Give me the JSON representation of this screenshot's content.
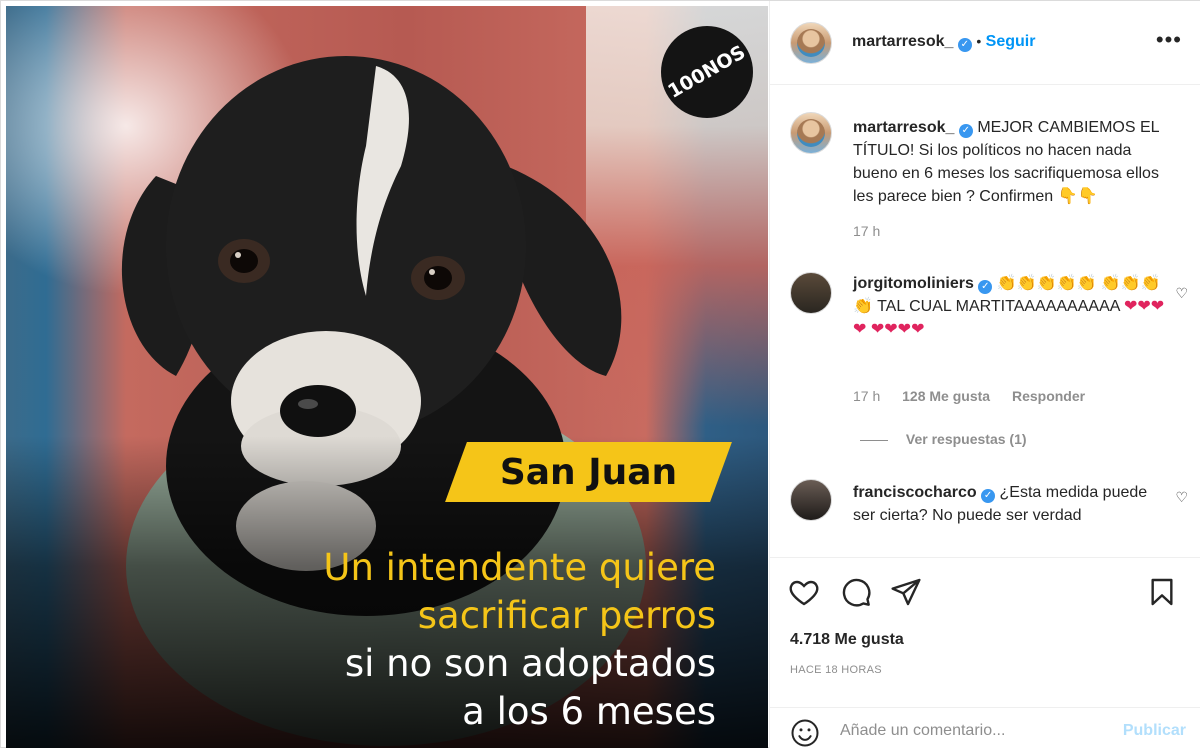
{
  "post": {
    "badge_text": "100NOS",
    "location_tag": "San Juan",
    "headline_yellow": [
      "Un intendente quiere",
      "sacrificar perros"
    ],
    "headline_white": [
      "si no son adoptados",
      "a los 6 meses"
    ]
  },
  "header": {
    "username": "martarresok_",
    "verified_mark": "✓",
    "separator": "•",
    "follow_label": "Seguir",
    "more_label": "•••"
  },
  "comments": [
    {
      "username": "martarresok_",
      "text": "MEJOR CAMBIEMOS EL TÍTULO! Si los políticos no hacen nada bueno en 6 meses los sacrifiquemosa ellos les parece bien ? Confirmen",
      "emoji": "👇👇",
      "time": "17 h"
    },
    {
      "username": "jorgitomoliniers",
      "emoji_claps_1": "👏👏👏👏👏",
      "emoji_claps_2": "👏👏👏👏",
      "text": "TAL CUAL MARTITAAAAAAAAAA",
      "emoji_hearts_1": "❤❤❤❤",
      "emoji_hearts_2": "❤❤❤❤",
      "time": "17 h",
      "likes": "128 Me gusta",
      "reply": "Responder",
      "view_replies": "Ver respuestas (1)"
    },
    {
      "username": "franciscocharco",
      "text": "¿Esta medida puede ser cierta? No puede ser verdad"
    }
  ],
  "actions": {
    "likes_count": "4.718 Me gusta",
    "timestamp": "HACE 18 HORAS"
  },
  "add_comment": {
    "placeholder": "Añade un comentario...",
    "publish_label": "Publicar"
  },
  "colors": {
    "accent": "#0095f6",
    "verified": "#3897f0",
    "tag_yellow": "#f5c518"
  }
}
